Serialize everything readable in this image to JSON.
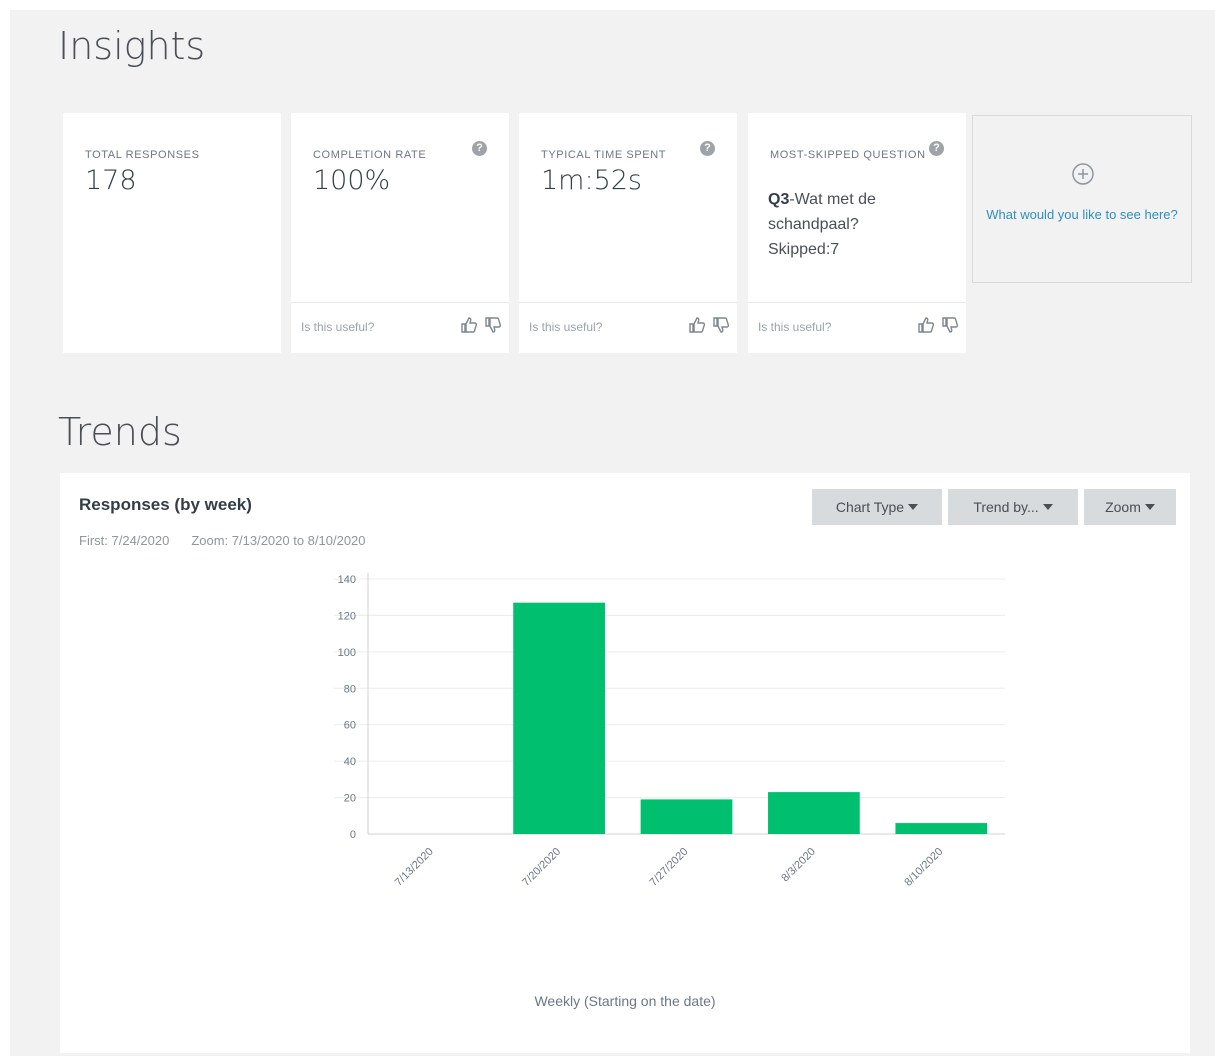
{
  "insights": {
    "title": "Insights",
    "cards": [
      {
        "label": "TOTAL RESPONSES",
        "value": "178"
      },
      {
        "label": "COMPLETION RATE",
        "value": "100%",
        "footer": "Is this useful?"
      },
      {
        "label": "TYPICAL TIME SPENT",
        "value": "1m:52s",
        "footer": "Is this useful?"
      },
      {
        "label": "MOST-SKIPPED QUESTION",
        "question_id": "Q3",
        "question_text": "-Wat met de schandpaal?",
        "skipped": "Skipped:7",
        "footer": "Is this useful?"
      }
    ],
    "add_card_text": "What would you like to see here?"
  },
  "trends": {
    "title": "Trends",
    "panel_title": "Responses (by week)",
    "first_label": "First: 7/24/2020",
    "zoom_label": "Zoom: 7/13/2020 to 8/10/2020",
    "buttons": {
      "chart_type": "Chart Type",
      "trend_by": "Trend by...",
      "zoom": "Zoom"
    }
  },
  "chart_data": {
    "type": "bar",
    "categories": [
      "7/13/2020",
      "7/20/2020",
      "7/27/2020",
      "8/3/2020",
      "8/10/2020"
    ],
    "values": [
      0,
      127,
      19,
      23,
      6
    ],
    "xlabel": "Weekly (Starting on the date)",
    "ylabel": "",
    "ylim": [
      0,
      140
    ],
    "yticks": [
      0,
      20,
      40,
      60,
      80,
      100,
      120,
      140
    ],
    "bar_color": "#00bf6f",
    "grid": true
  }
}
